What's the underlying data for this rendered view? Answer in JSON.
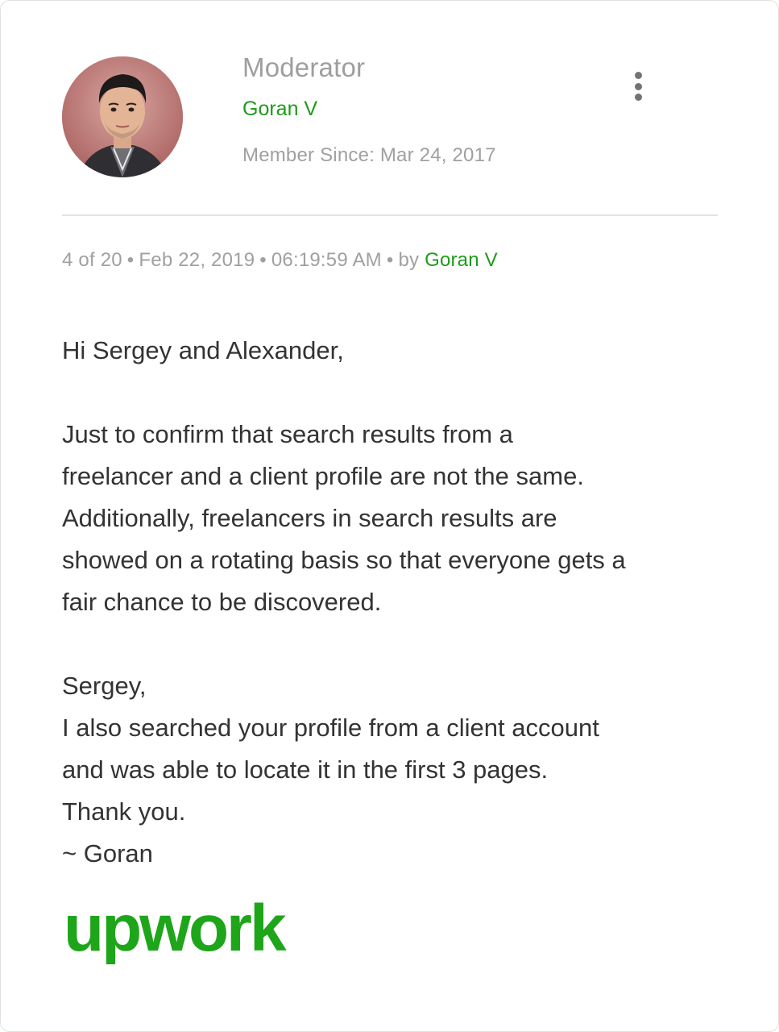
{
  "post": {
    "author": {
      "role": "Moderator",
      "name": "Goran V",
      "member_since": "Member Since: Mar 24, 2017"
    },
    "meta": {
      "position": "4 of 20",
      "date": "Feb 22, 2019",
      "time": "06:19:59 AM",
      "by_prefix": "by",
      "by_name": "Goran V",
      "separator": "•"
    },
    "body": {
      "greeting": "Hi Sergey and Alexander,",
      "paragraph1_lines": [
        "Just to confirm that search results from a",
        "freelancer and a client profile are not the same.",
        "Additionally, freelancers in search results are",
        "showed on a rotating basis so that everyone gets a",
        "fair chance to be discovered."
      ],
      "paragraph2_lines": [
        "Sergey,",
        "I also searched your profile from a client account",
        "and was able to locate it in the first 3 pages.",
        "Thank you.",
        "~ Goran"
      ]
    },
    "logo": "upwork"
  },
  "colors": {
    "brand_green": "#1e9b1a",
    "muted_text": "#a0a0a0",
    "body_text": "#333333"
  },
  "icons": {
    "menu": "more-vertical-icon"
  }
}
